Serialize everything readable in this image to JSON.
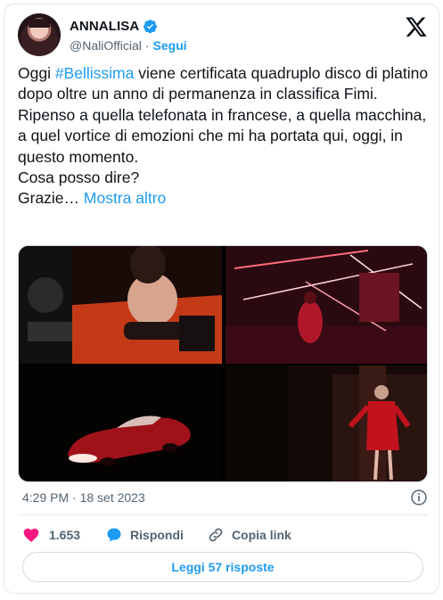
{
  "author": {
    "display_name": "ANNALISA",
    "handle": "@NaliOfficial",
    "separator": "·",
    "follow_label": "Segui"
  },
  "tweet": {
    "text_before_hashtag": "Oggi ",
    "hashtag": "#Bellissima",
    "text_after_hashtag": " viene certificata quadruplo disco di platino dopo oltre un anno di permanenza in classifica Fimi.\nRipenso a quella telefonata in francese, a quella macchina, a quel vortice di emozioni che mi ha portata qui, oggi, in questo momento.\nCosa posso dire?\nGrazie… ",
    "show_more": "Mostra altro",
    "timestamp": "4:29 PM · 18 set 2023"
  },
  "media": {
    "photo_count": 4
  },
  "actions": {
    "like_count": "1.653",
    "reply_label": "Rispondi",
    "copy_link_label": "Copia link",
    "read_replies_label": "Leggi 57 risposte"
  },
  "colors": {
    "accent": "#1d9bf0",
    "like": "#f91880",
    "text": "#0f1419",
    "muted": "#536471"
  }
}
